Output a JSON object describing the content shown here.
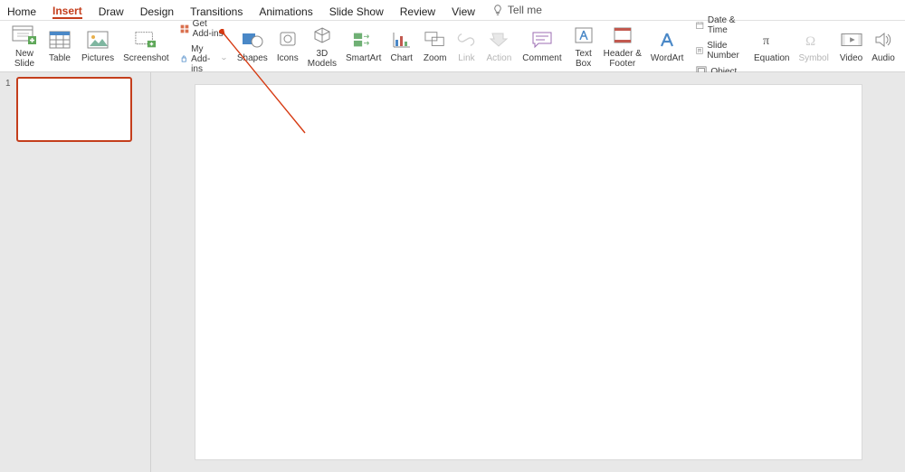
{
  "tabs": {
    "home": "Home",
    "insert": "Insert",
    "draw": "Draw",
    "design": "Design",
    "transitions": "Transitions",
    "animations": "Animations",
    "slideshow": "Slide Show",
    "review": "Review",
    "view": "View",
    "tellme": "Tell me"
  },
  "ribbon": {
    "newslide": "New\nSlide",
    "table": "Table",
    "pictures": "Pictures",
    "screenshot": "Screenshot",
    "getaddins": "Get Add-ins",
    "myaddins": "My Add-ins",
    "shapes": "Shapes",
    "icons": "Icons",
    "models": "3D\nModels",
    "smartart": "SmartArt",
    "chart": "Chart",
    "zoom": "Zoom",
    "link": "Link",
    "action": "Action",
    "comment": "Comment",
    "textbox": "Text\nBox",
    "headerfooter": "Header &\nFooter",
    "wordart": "WordArt",
    "datetime": "Date & Time",
    "slidenumber": "Slide Number",
    "object": "Object",
    "equation": "Equation",
    "symbol": "Symbol",
    "video": "Video",
    "audio": "Audio"
  },
  "slide": {
    "number": "1"
  }
}
